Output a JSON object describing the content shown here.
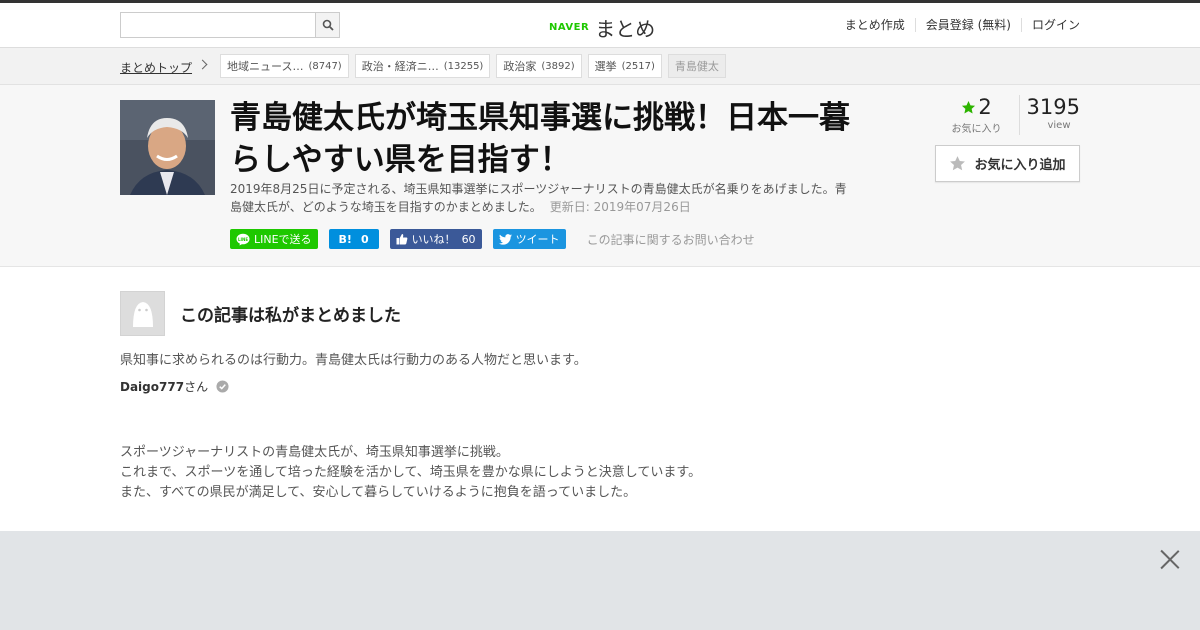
{
  "header": {
    "search_placeholder": "",
    "logo_naver": "NAVER",
    "logo_matome": "まとめ",
    "nav": [
      "まとめ作成",
      "会員登録 (無料)",
      "ログイン"
    ]
  },
  "breadcrumb": {
    "top": "まとめトップ",
    "tags": [
      {
        "label": "地域ニュース…",
        "count": "(8747)"
      },
      {
        "label": "政治・経済ニ…",
        "count": "(13255)"
      },
      {
        "label": "政治家",
        "count": "(3892)"
      },
      {
        "label": "選挙",
        "count": "(2517)"
      },
      {
        "label": "青島健太",
        "count": ""
      }
    ]
  },
  "article": {
    "title": "青島健太氏が埼玉県知事選に挑戦！日本一暮らしやすい県を目指す！",
    "description": "2019年8月25日に予定される、埼玉県知事選挙にスポーツジャーナリストの青島健太氏が名乗りをあげました。青島健太氏が、どのような埼玉を目指すのかまとめました。",
    "updated": "更新日: 2019年07月26日",
    "favorites": "2",
    "favorites_label": "お気に入り",
    "views": "3195",
    "views_label": "view",
    "fav_button": "お気に入り追加"
  },
  "social": {
    "line": "LINEで送る",
    "hatena_label": "B!",
    "hatena_count": "0",
    "fb_label": "いいね！",
    "fb_count": "60",
    "tweet": "ツイート",
    "inquiry": "この記事に関するお問い合わせ"
  },
  "author": {
    "heading": "この記事は私がまとめました",
    "desc": "県知事に求められるのは行動力。青島健太氏は行動力のある人物だと思います。",
    "name": "Daigo777",
    "suffix": "さん"
  },
  "body": {
    "lines": [
      "スポーツジャーナリストの青島健太氏が、埼玉県知事選挙に挑戦。",
      "これまで、スポーツを通して培った経験を活かして、埼玉県を豊かな県にしようと決意しています。",
      "また、すべての県民が満足して、安心して暮らしていけるように抱負を語っていました。"
    ]
  },
  "colors": {
    "line_green": "#1ec800",
    "hatena_blue": "#008fde",
    "fb_blue": "#3b5998",
    "twitter_blue": "#1b95e0",
    "star_green": "#2db400"
  }
}
